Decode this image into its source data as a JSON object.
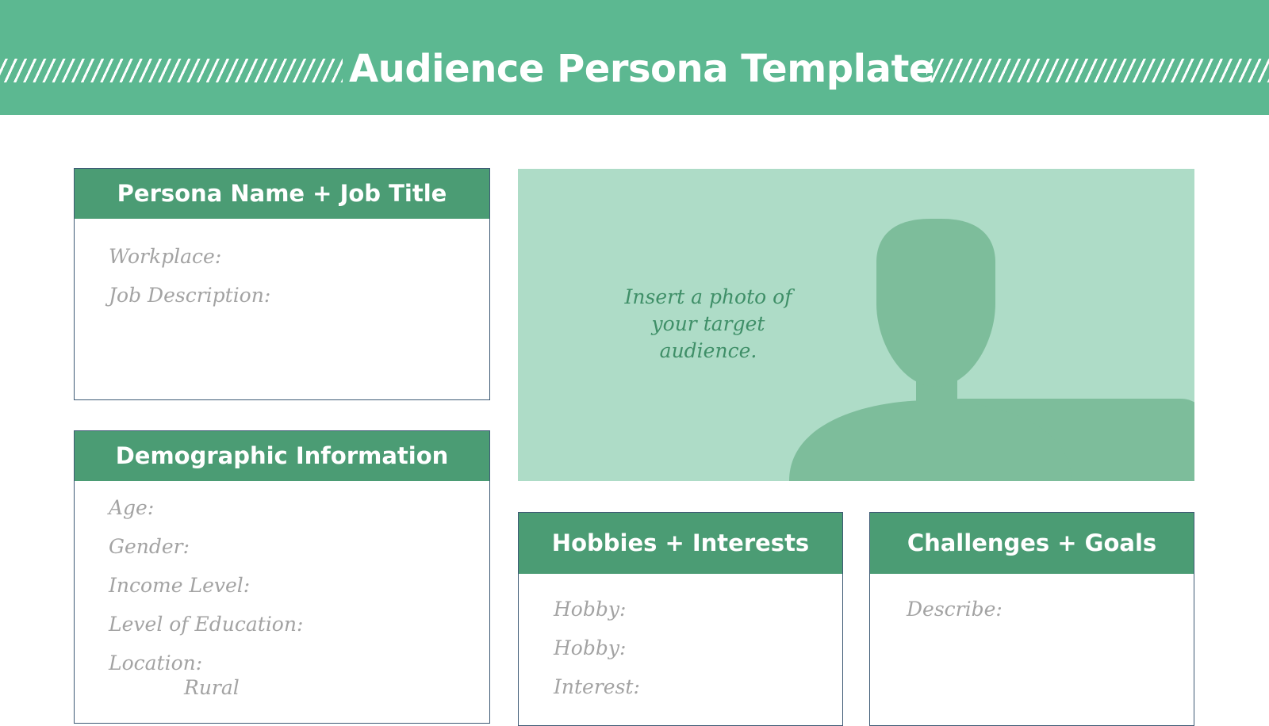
{
  "banner": {
    "title": "Audience Persona Template"
  },
  "photo": {
    "placeholder_lines": [
      "Insert a photo of",
      "your target",
      "audience."
    ]
  },
  "cards": {
    "persona": {
      "title": "Persona Name + Job Title",
      "fields": [
        "Workplace:",
        "Job Description:"
      ]
    },
    "demographic": {
      "title": "Demographic Information",
      "fields": [
        "Age:",
        "Gender:",
        "Income Level:",
        "Level of Education:",
        "Location:"
      ],
      "location_option": "Rural"
    },
    "hobbies": {
      "title": "Hobbies + Interests",
      "fields": [
        "Hobby:",
        "Hobby:",
        "Interest:"
      ]
    },
    "goals": {
      "title": "Challenges + Goals",
      "fields": [
        "Describe:"
      ]
    }
  },
  "colors": {
    "banner": "#5cb891",
    "card_header": "#4b9c74",
    "photo_bg": "#aedcc7",
    "silhouette": "#7dbd9b",
    "card_border": "#3e5a75",
    "field_text": "#a3a3a3"
  }
}
